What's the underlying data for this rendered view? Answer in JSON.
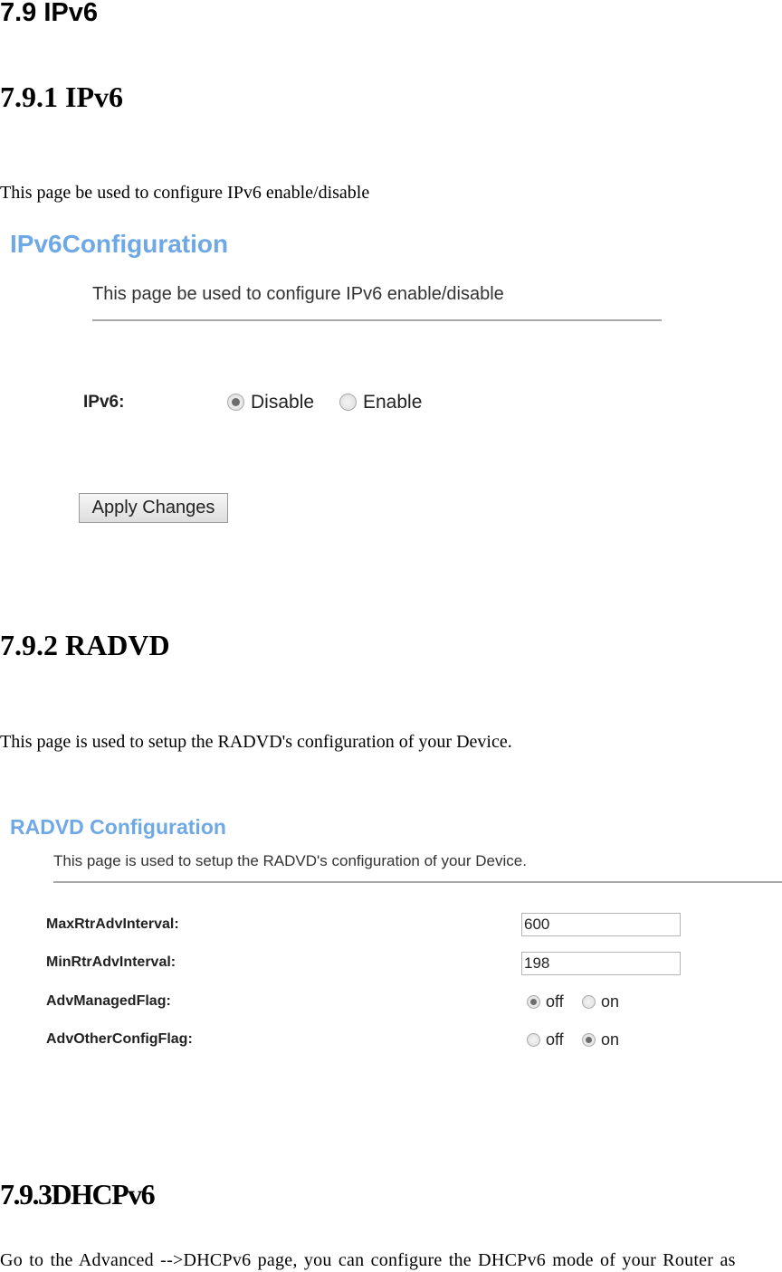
{
  "section": {
    "title": "7.9 IPv6"
  },
  "ipv6": {
    "heading": "7.9.1 IPv6",
    "description": "This page be used to configure IPv6 enable/disable",
    "screenshot": {
      "title": "IPv6Configuration",
      "subtitle": "This page be used to configure IPv6 enable/disable",
      "field_label": "IPv6:",
      "options": [
        {
          "label": "Disable",
          "selected": true
        },
        {
          "label": "Enable",
          "selected": false
        }
      ],
      "apply_label": "Apply Changes"
    }
  },
  "radvd": {
    "heading": "7.9.2 RADVD",
    "description": "This page is used to setup the RADVD's configuration of your Device.",
    "screenshot": {
      "title": "RADVD Configuration",
      "subtitle": "This page is used to setup the RADVD's configuration of your Device.",
      "fields": [
        {
          "label": "MaxRtrAdvInterval:",
          "value": "600"
        },
        {
          "label": "MinRtrAdvInterval:",
          "value": "198"
        }
      ],
      "flags": [
        {
          "label": "AdvManagedFlag:",
          "options": [
            {
              "label": "off",
              "selected": true
            },
            {
              "label": "on",
              "selected": false
            }
          ]
        },
        {
          "label": "AdvOtherConfigFlag:",
          "options": [
            {
              "label": "off",
              "selected": false
            },
            {
              "label": "on",
              "selected": true
            }
          ]
        }
      ]
    }
  },
  "dhcpv6": {
    "heading": "7.9.3DHCPv6",
    "description": "Go to the Advanced -->DHCPv6 page, you can configure the DHCPv6 mode of your Router as"
  },
  "colors": {
    "panel_title": "#6fa8e6",
    "rule": "#a8a8a8"
  }
}
